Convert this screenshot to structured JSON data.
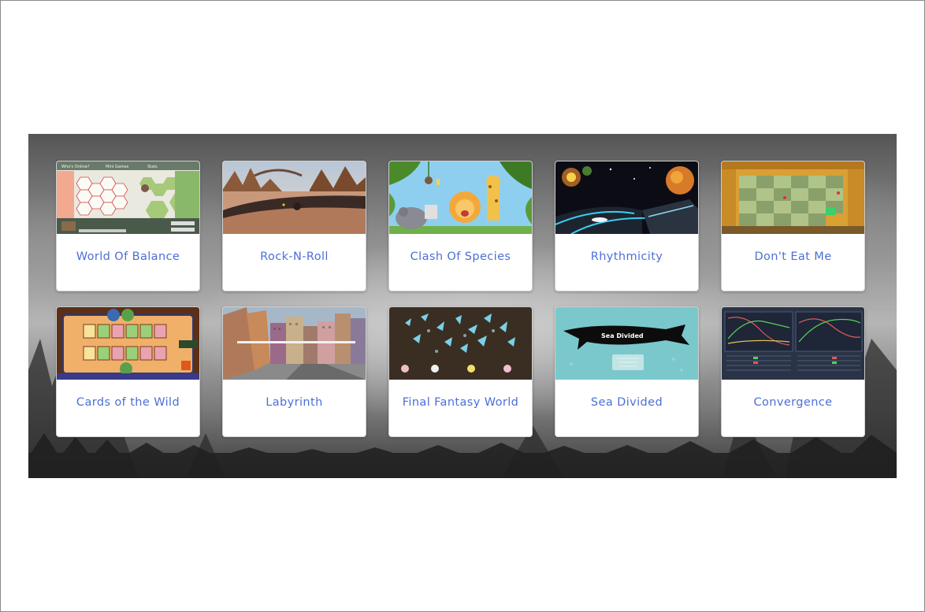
{
  "games": [
    {
      "title": "World Of Balance",
      "tabs": [
        "Who's Online?",
        "Mini Games",
        "Stats"
      ]
    },
    {
      "title": "Rock-N-Roll"
    },
    {
      "title": "Clash Of Species"
    },
    {
      "title": "Rhythmicity"
    },
    {
      "title": "Don't Eat Me"
    },
    {
      "title": "Cards of the Wild"
    },
    {
      "title": "Labyrinth"
    },
    {
      "title": "Final Fantasy World"
    },
    {
      "title": "Sea Divided",
      "logo_text": "Sea Divided"
    },
    {
      "title": "Convergence"
    }
  ],
  "colors": {
    "link": "#4c6fd6",
    "card_bg": "#ffffff"
  }
}
